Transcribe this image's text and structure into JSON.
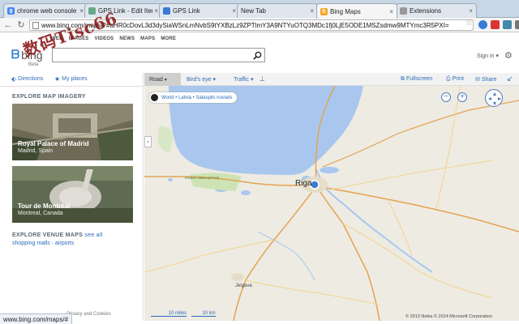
{
  "browser": {
    "tabs": [
      {
        "title": "chrome web console sto",
        "icon": "google-icon",
        "color": "#4285f4"
      },
      {
        "title": "GPS Link - Edit Item",
        "icon": "map-pin-icon",
        "color": "#6a8"
      },
      {
        "title": "GPS Link",
        "icon": "map-pin-icon",
        "color": "#3a7bd5"
      },
      {
        "title": "New Tab",
        "icon": "blank-icon",
        "color": "#ccc"
      },
      {
        "title": "Bing Maps",
        "icon": "bing-icon",
        "color": "#f5a623"
      },
      {
        "title": "Extensions",
        "icon": "puzzle-icon",
        "color": "#999"
      }
    ],
    "url": "www.bing.com/maps/?#aHR0cDovL3d3dySiaWSnLmNvbS9tYXBzLz9ZPTlmY3A9NTYuOTQ3MDc1fj0LjE5ODE1MSZsdmw9MTYmc3R5PXI="
  },
  "bing": {
    "nav": [
      "WEB",
      "IMAGES",
      "VIDEOS",
      "NEWS",
      "MAPS",
      "MORE"
    ],
    "logo": "bing",
    "beta": "Beta",
    "signin": "Sign in"
  },
  "left": {
    "directions": "Directions",
    "my_places": "My places",
    "explore_title": "EXPLORE MAP IMAGERY",
    "cards": [
      {
        "title": "Royal Palace of Madrid",
        "sub": "Madrid, Spain"
      },
      {
        "title": "Tour de Montréal",
        "sub": "Montreal, Canada"
      }
    ],
    "venue_title": "EXPLORE VENUE MAPS",
    "see_all": "see all",
    "venue_links": "shopping malls · airports",
    "privacy": "Privacy and Cookies"
  },
  "maptools": {
    "road": "Road",
    "birds_eye": "Bird's eye",
    "traffic": "Traffic",
    "fullscreen": "Fullscreen",
    "print": "Print",
    "share": "Share"
  },
  "map": {
    "breadcrumb": "World • Latvia • Salaspils novads",
    "cities": {
      "riga": "Riga",
      "jelgava": "Jelgava",
      "kemeri": "Kemeri National Park"
    },
    "scale_miles": "10 miles",
    "scale_km": "10 km",
    "copyright": "© 2013 Nokia   © 2014 Microsoft Corporation"
  },
  "status": "www.bing.com/maps/#",
  "watermark": "数码Tisc66"
}
